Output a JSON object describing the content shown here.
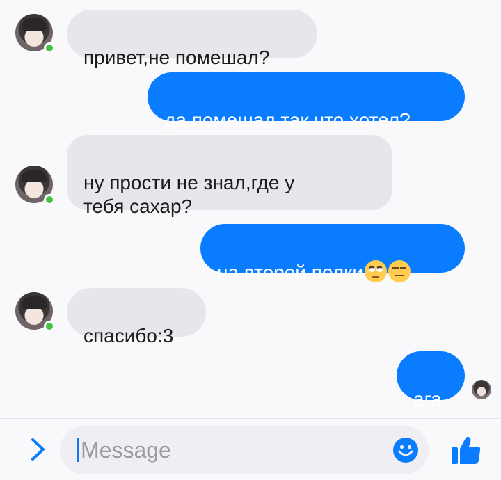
{
  "conversation": {
    "messages": [
      {
        "direction": "in",
        "text": "привет,не помешал?",
        "show_avatar": true
      },
      {
        "direction": "out",
        "text": "да помешал,так что хотел?"
      },
      {
        "direction": "in",
        "text": "ну прости не знал,где у\nтебя сахар?",
        "show_avatar": true
      },
      {
        "direction": "out",
        "text": "на второй полки",
        "emojis": [
          "face-with-rolling-eyes",
          "expressionless-face"
        ]
      },
      {
        "direction": "in",
        "text": "спасибо:3",
        "show_avatar": true
      },
      {
        "direction": "out",
        "text": "ага",
        "seen_receipt": true
      }
    ]
  },
  "composer": {
    "placeholder": "Message",
    "value": "",
    "expand_icon": "chevron-right-icon",
    "emoji_icon": "smiley-icon",
    "like_icon": "thumbs-up-icon"
  },
  "colors": {
    "outgoing_bubble": "#0a7cff",
    "incoming_bubble": "#e6e6eb",
    "online_dot": "#41c33c",
    "accent": "#0a7cff",
    "background": "#f9f9fc"
  }
}
